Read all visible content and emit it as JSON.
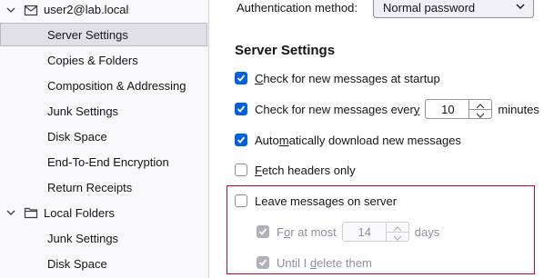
{
  "sidebar": {
    "account": "user2@lab.local",
    "account_items": [
      "Server Settings",
      "Copies & Folders",
      "Composition & Addressing",
      "Junk Settings",
      "Disk Space",
      "End-To-End Encryption",
      "Return Receipts"
    ],
    "local_folders": "Local Folders",
    "local_items": [
      "Junk Settings",
      "Disk Space"
    ]
  },
  "auth": {
    "label": "Authentication method:",
    "value": "Normal password"
  },
  "section_title": "Server Settings",
  "options": {
    "check_startup": {
      "pre": "",
      "u": "C",
      "post": "heck for new messages at startup",
      "checked": true
    },
    "check_every": {
      "pre": "Check for new messages ever",
      "u": "y",
      "post": "",
      "value": "10",
      "unit": "minutes",
      "checked": true
    },
    "auto_download": {
      "pre": "Auto",
      "u": "m",
      "post": "atically download new messages",
      "checked": true
    },
    "fetch_headers": {
      "pre": "",
      "u": "F",
      "post": "etch headers only",
      "checked": false
    },
    "leave_on_server": {
      "pre": "Leave messa",
      "u": "g",
      "post": "es on server",
      "checked": false
    },
    "for_at_most": {
      "pre": "F",
      "u": "o",
      "post": "r at most",
      "value": "14",
      "unit": "days",
      "checked": true,
      "disabled": true
    },
    "until_delete": {
      "pre": "Until I ",
      "u": "d",
      "post": "elete them",
      "checked": true,
      "disabled": true
    }
  },
  "colors": {
    "accent": "#0060df",
    "highlight_box": "#d70022",
    "selected_bg": "#e0e0e6"
  }
}
